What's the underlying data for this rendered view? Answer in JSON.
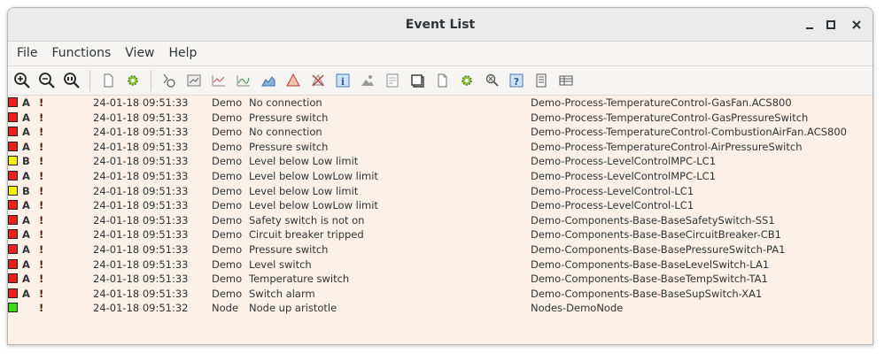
{
  "window": {
    "title": "Event List"
  },
  "menu": [
    "File",
    "Functions",
    "View",
    "Help"
  ],
  "toolbar": {
    "group1": [
      "zoom-in-icon",
      "zoom-out-icon",
      "zoom-reset-icon"
    ],
    "group2": [
      "document-icon",
      "gear-icon"
    ],
    "group3": [
      "history-icon",
      "graph-icon",
      "trend-icon",
      "trend-curve-icon",
      "area-chart-icon",
      "warning-triangle-icon",
      "delete-icon",
      "info-icon",
      "image-icon",
      "note-icon",
      "window-icon",
      "copy-document-icon",
      "settings-gear-icon",
      "search-crossref-icon",
      "help-icon",
      "list-icon",
      "table-icon"
    ]
  },
  "colors": {
    "A": "#e8201e",
    "B": "#f5f200",
    "info": "#3ddc14",
    "list_bg": "#fdf0e6"
  },
  "events": [
    {
      "sev": "A",
      "prio": "A",
      "mark": "!",
      "time": "24-01-18 09:51:33",
      "src": "Demo",
      "text": "No connection",
      "object": "Demo-Process-TemperatureControl-GasFan.ACS800"
    },
    {
      "sev": "A",
      "prio": "A",
      "mark": "!",
      "time": "24-01-18 09:51:33",
      "src": "Demo",
      "text": "Pressure switch",
      "object": "Demo-Process-TemperatureControl-GasPressureSwitch"
    },
    {
      "sev": "A",
      "prio": "A",
      "mark": "!",
      "time": "24-01-18 09:51:33",
      "src": "Demo",
      "text": "No connection",
      "object": "Demo-Process-TemperatureControl-CombustionAirFan.ACS800"
    },
    {
      "sev": "A",
      "prio": "A",
      "mark": "!",
      "time": "24-01-18 09:51:33",
      "src": "Demo",
      "text": "Pressure switch",
      "object": "Demo-Process-TemperatureControl-AirPressureSwitch"
    },
    {
      "sev": "B",
      "prio": "B",
      "mark": "!",
      "time": "24-01-18 09:51:33",
      "src": "Demo",
      "text": "Level below Low limit",
      "object": "Demo-Process-LevelControlMPC-LC1"
    },
    {
      "sev": "A",
      "prio": "A",
      "mark": "!",
      "time": "24-01-18 09:51:33",
      "src": "Demo",
      "text": "Level below LowLow limit",
      "object": "Demo-Process-LevelControlMPC-LC1"
    },
    {
      "sev": "B",
      "prio": "B",
      "mark": "!",
      "time": "24-01-18 09:51:33",
      "src": "Demo",
      "text": "Level below Low limit",
      "object": "Demo-Process-LevelControl-LC1"
    },
    {
      "sev": "A",
      "prio": "A",
      "mark": "!",
      "time": "24-01-18 09:51:33",
      "src": "Demo",
      "text": "Level below LowLow limit",
      "object": "Demo-Process-LevelControl-LC1"
    },
    {
      "sev": "A",
      "prio": "A",
      "mark": "!",
      "time": "24-01-18 09:51:33",
      "src": "Demo",
      "text": "Safety switch is not on",
      "object": "Demo-Components-Base-BaseSafetySwitch-SS1"
    },
    {
      "sev": "A",
      "prio": "A",
      "mark": "!",
      "time": "24-01-18 09:51:33",
      "src": "Demo",
      "text": "Circuit breaker tripped",
      "object": "Demo-Components-Base-BaseCircuitBreaker-CB1"
    },
    {
      "sev": "A",
      "prio": "A",
      "mark": "!",
      "time": "24-01-18 09:51:33",
      "src": "Demo",
      "text": "Pressure switch",
      "object": "Demo-Components-Base-BasePressureSwitch-PA1"
    },
    {
      "sev": "A",
      "prio": "A",
      "mark": "!",
      "time": "24-01-18 09:51:33",
      "src": "Demo",
      "text": "Level switch",
      "object": "Demo-Components-Base-BaseLevelSwitch-LA1"
    },
    {
      "sev": "A",
      "prio": "A",
      "mark": "!",
      "time": "24-01-18 09:51:33",
      "src": "Demo",
      "text": "Temperature switch",
      "object": "Demo-Components-Base-BaseTempSwitch-TA1"
    },
    {
      "sev": "A",
      "prio": "A",
      "mark": "!",
      "time": "24-01-18 09:51:33",
      "src": "Demo",
      "text": "Switch alarm",
      "object": "Demo-Components-Base-BaseSupSwitch-XA1"
    },
    {
      "sev": "info",
      "prio": "",
      "mark": "!",
      "time": "24-01-18 09:51:32",
      "src": "Node",
      "text": "Node up aristotle",
      "object": "Nodes-DemoNode"
    }
  ]
}
